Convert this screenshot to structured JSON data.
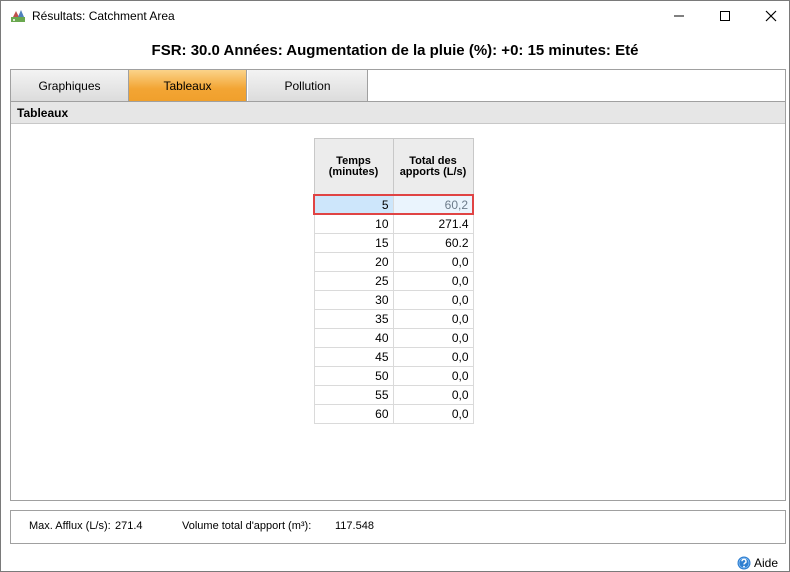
{
  "window": {
    "title": "Résultats: Catchment Area",
    "icon": "rainfall-app-icon"
  },
  "header": {
    "text": "FSR: 30.0 Années: Augmentation de la pluie (%): +0: 15 minutes: Eté"
  },
  "tabs": [
    {
      "label": "Graphiques",
      "active": false
    },
    {
      "label": "Tableaux",
      "active": true
    },
    {
      "label": "Pollution",
      "active": false
    }
  ],
  "section": {
    "title": "Tableaux"
  },
  "table": {
    "headers": [
      "Temps\n(minutes)",
      "Total des\napports (L/s)"
    ],
    "rows": [
      [
        "5",
        "60,2"
      ],
      [
        "10",
        "271.4"
      ],
      [
        "15",
        "60.2"
      ],
      [
        "20",
        "0,0"
      ],
      [
        "25",
        "0,0"
      ],
      [
        "30",
        "0,0"
      ],
      [
        "35",
        "0,0"
      ],
      [
        "40",
        "0,0"
      ],
      [
        "45",
        "0,0"
      ],
      [
        "50",
        "0,0"
      ],
      [
        "55",
        "0,0"
      ],
      [
        "60",
        "0,0"
      ]
    ],
    "selected_row": 0
  },
  "summary": {
    "max_label": "Max. Afflux (L/s):",
    "max_value": "271.4",
    "volume_label": "Volume total d'apport (m³):",
    "volume_value": "117.548"
  },
  "help": {
    "label": "Aide",
    "icon": "help-icon"
  },
  "colors": {
    "active_tab": "#f3a534",
    "selection_border": "#e04444",
    "selection_fill": "#cde6fb"
  }
}
